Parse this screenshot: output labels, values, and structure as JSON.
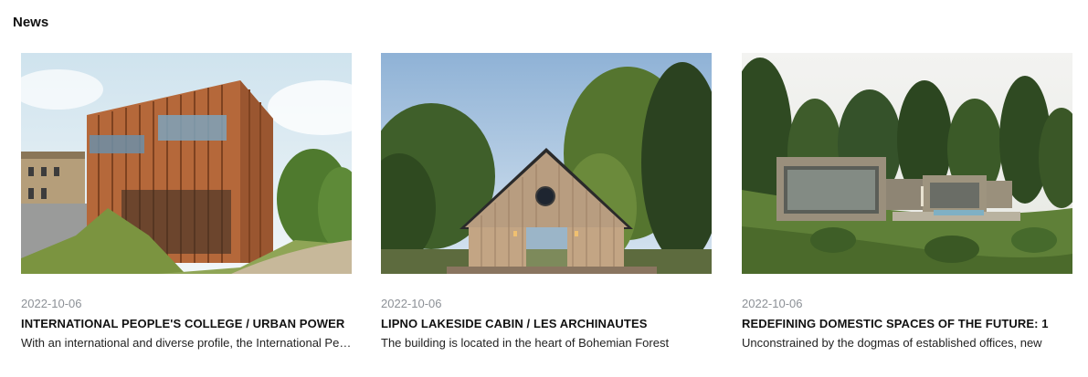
{
  "section": {
    "title": "News"
  },
  "articles": [
    {
      "date": "2022-10-06",
      "title": "INTERNATIONAL PEOPLE'S COLLEGE / URBAN POWER",
      "excerpt": "With an international and diverse profile, the International People's College",
      "image": "timber-slatted-college-building-photo"
    },
    {
      "date": "2022-10-06",
      "title": "LIPNO LAKESIDE CABIN / LES ARCHINAUTES",
      "excerpt": "The building is located in the heart of Bohemian Forest",
      "image": "gabled-wooden-cabin-photo"
    },
    {
      "date": "2022-10-06",
      "title": "REDEFINING DOMESTIC SPACES OF THE FUTURE: 1",
      "excerpt": "Unconstrained by the dogmas of established offices, new",
      "image": "concrete-hillside-house-render"
    }
  ]
}
